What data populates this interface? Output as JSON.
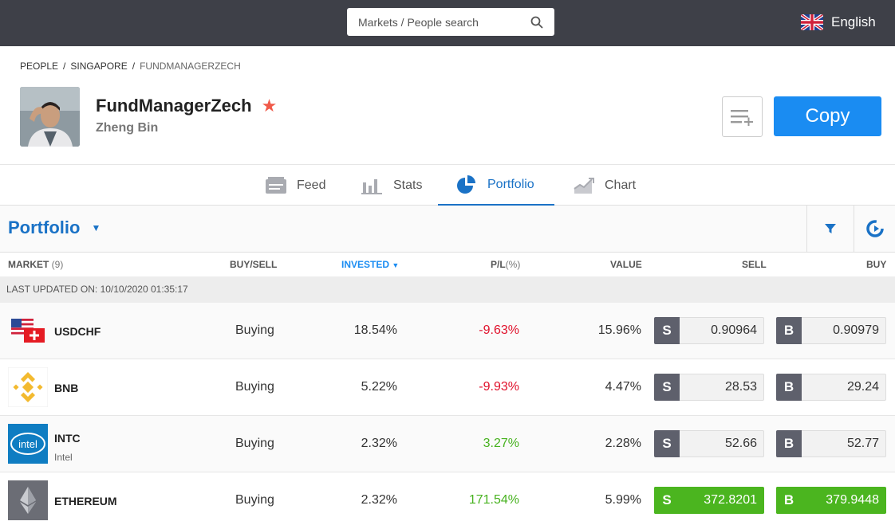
{
  "header": {
    "search_placeholder": "Markets / People search",
    "language": "English"
  },
  "breadcrumb": [
    "PEOPLE",
    "SINGAPORE",
    "FUNDMANAGERZECH"
  ],
  "profile": {
    "username": "FundManagerZech",
    "real_name": "Zheng Bin",
    "copy_label": "Copy"
  },
  "tabs": [
    {
      "label": "Feed",
      "icon": "feed-icon"
    },
    {
      "label": "Stats",
      "icon": "stats-icon"
    },
    {
      "label": "Portfolio",
      "icon": "pie-chart-icon",
      "active": true
    },
    {
      "label": "Chart",
      "icon": "chart-icon"
    }
  ],
  "portfolio": {
    "title": "Portfolio",
    "columns": {
      "market": "MARKET",
      "market_count": "(9)",
      "buysell": "BUY/SELL",
      "invested": "INVESTED",
      "pl": "P/L",
      "pl_unit": "(%)",
      "value": "VALUE",
      "sell": "SELL",
      "buy": "BUY"
    },
    "last_updated": "LAST UPDATED ON: 10/10/2020 01:35:17",
    "rows": [
      {
        "symbol": "USDCHF",
        "name": "",
        "action": "Buying",
        "invested": "18.54%",
        "pl": "-9.63%",
        "value": "15.96%",
        "sell": "0.90964",
        "buy": "0.90979"
      },
      {
        "symbol": "BNB",
        "name": "",
        "action": "Buying",
        "invested": "5.22%",
        "pl": "-9.93%",
        "value": "4.47%",
        "sell": "28.53",
        "buy": "29.24"
      },
      {
        "symbol": "INTC",
        "name": "Intel",
        "action": "Buying",
        "invested": "2.32%",
        "pl": "3.27%",
        "value": "2.28%",
        "sell": "52.66",
        "buy": "52.77"
      },
      {
        "symbol": "ETHEREUM",
        "name": "",
        "action": "Buying",
        "invested": "2.32%",
        "pl": "171.54%",
        "value": "5.99%",
        "sell": "372.8201",
        "buy": "379.9448"
      }
    ],
    "sell_tag": "S",
    "buy_tag": "B",
    "intel_logo_text": "intel"
  },
  "colors": {
    "accent": "#1a72c6",
    "copy_button": "#1a8cf2",
    "negative": "#e0112b",
    "positive": "#47b21f"
  }
}
